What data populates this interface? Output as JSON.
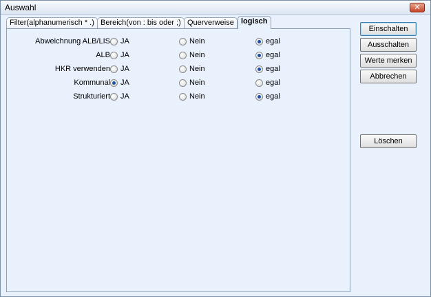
{
  "window": {
    "title": "Auswahl",
    "close_symbol": "✕"
  },
  "tabs": [
    {
      "label": "Filter(alphanumerisch * .)",
      "active": false
    },
    {
      "label": "Bereich(von : bis  oder ;)",
      "active": false
    },
    {
      "label": "Querverweise",
      "active": false
    },
    {
      "label": "logisch",
      "active": true
    }
  ],
  "options": [
    "JA",
    "Nein",
    "egal"
  ],
  "rows": [
    {
      "label": "Abweichnung ALB/LIS",
      "selected": "egal"
    },
    {
      "label": "ALB",
      "selected": "egal"
    },
    {
      "label": "HKR verwenden",
      "selected": "egal"
    },
    {
      "label": "Kommunal",
      "selected": "JA"
    },
    {
      "label": "Strukturiert",
      "selected": "egal"
    }
  ],
  "buttons": {
    "einschalten": "Einschalten",
    "ausschalten": "Ausschalten",
    "werte_merken": "Werte merken",
    "abbrechen": "Abbrechen",
    "loeschen": "Löschen"
  }
}
